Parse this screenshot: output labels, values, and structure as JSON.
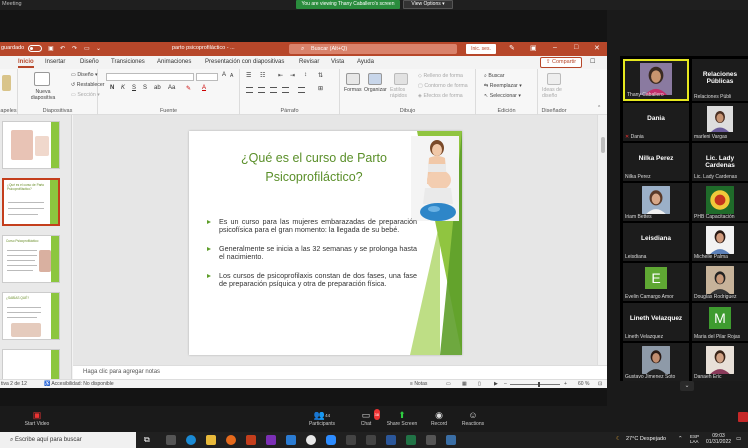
{
  "zoom": {
    "meeting_title": "Meeting",
    "share_banner": "You are viewing Thany Caballero's screen",
    "view_options": "View Options",
    "toolbar": {
      "video_label": "Start Video",
      "participants_label": "Participants",
      "participants_count": "44",
      "chat_label": "Chat",
      "chat_badge": "38",
      "share_label": "Share Screen",
      "record_label": "Record",
      "reactions_label": "Reactions"
    }
  },
  "ppt": {
    "autosave": "guardado",
    "doc_title": "parto psicoprofiláctico - ...",
    "search_placeholder": "Buscar (Alt+Q)",
    "signin": "Inic. ses.",
    "tabs": [
      "Inicio",
      "Insertar",
      "Diseño",
      "Transiciones",
      "Animaciones",
      "Presentación con diapositivas",
      "Revisar",
      "Vista",
      "Ayuda"
    ],
    "share_button": "Compartir",
    "ribbon": {
      "portapapeles": "apeles",
      "diapositivas": "Diapositivas",
      "nueva_diapositiva": "Nueva diapositiva",
      "diseno": "Diseño",
      "restablecer": "Restablecer",
      "seccion": "Sección",
      "fuente": "Fuente",
      "parrafo": "Párrafo",
      "dibujo": "Dibujo",
      "formas": "Formas",
      "organizar": "Organizar",
      "estilos_rapidos": "Estilos rápidos",
      "relleno": "Relleno de forma",
      "contorno": "Contorno de forma",
      "efectos": "Efectos de forma",
      "edicion": "Edición",
      "buscar": "Buscar",
      "reemplazar": "Reemplazar",
      "seleccionar": "Seleccionar",
      "disenador": "Diseñador",
      "ideas": "Ideas de diseño"
    },
    "slide": {
      "title_line1": "¿Qué es el curso de Parto",
      "title_line2": "Psicoprofiláctico?",
      "bullets": [
        "Es un curso para las mujeres embarazadas de preparación psicofísica para el gran momento: la llegada de su bebé.",
        "Generalmente se inicia a las 32 semanas y se prolonga hasta el nacimiento.",
        "Los cursos de psicoprofilaxis constan de dos fases, una fase de preparación psíquica y otra de preparación física."
      ]
    },
    "thumbnails": {
      "slide2_title": "¿Qué es el curso de Parto Psicoprofiláctico?",
      "slide3_title": "Curso Psicoprofiláctico",
      "slide4_title": "¿SABÍAS QUÉ?"
    },
    "notes_placeholder": "Haga clic para agregar notas",
    "status": {
      "slide_count": "tiva 2 de 12",
      "accessibility": "Accesibilidad: No disponible",
      "notes": "Notas",
      "zoom": "60 %"
    }
  },
  "participants": [
    {
      "name": "Thany Caballero",
      "type": "video",
      "active": true
    },
    {
      "name": "Relaciones Públi",
      "display": "Relaciones Públicas",
      "type": "name"
    },
    {
      "name": "Dania",
      "display": "Dania",
      "type": "name"
    },
    {
      "name": "marleni Vargas",
      "type": "video"
    },
    {
      "name": "Nilka Perez",
      "display": "Nilka Perez",
      "type": "name"
    },
    {
      "name": "Lic. Lady Cardenas",
      "display": "Lic. Lady Cardenas",
      "type": "name"
    },
    {
      "name": "Iriam Bettes",
      "type": "video"
    },
    {
      "name": "PHB Capacitación",
      "type": "video"
    },
    {
      "name": "Leisdiana",
      "display": "Leisdiana",
      "type": "name"
    },
    {
      "name": "Michelle Palma",
      "type": "video"
    },
    {
      "name": "Evelin Camargo Amor",
      "letter": "E",
      "type": "letter"
    },
    {
      "name": "Douglas Rodriguez",
      "type": "video"
    },
    {
      "name": "Lineth Velazquez",
      "display": "Lineth Velazquez",
      "type": "name"
    },
    {
      "name": "Maria del Pilar Rojas",
      "letter": "M",
      "type": "letter"
    },
    {
      "name": "Gustavo Jimenez Soto",
      "type": "video"
    },
    {
      "name": "Danaeh Eric",
      "type": "video"
    }
  ],
  "taskbar": {
    "search": "Escribe aquí para buscar",
    "weather": "27°C Despejado",
    "lang": "ESP LAA",
    "time": "09:03",
    "date": "01/31/2022"
  }
}
